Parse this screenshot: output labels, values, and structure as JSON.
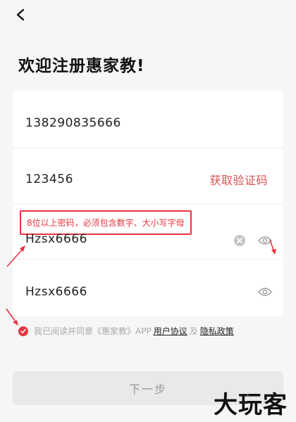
{
  "header": {
    "back_icon": "chevron-left-icon"
  },
  "page": {
    "title": "欢迎注册惠家教!"
  },
  "form": {
    "phone_value": "138290835666",
    "code_value": "123456",
    "get_code_label": "获取验证码",
    "password_hint": "8位以上密码，必须包含数字、大小写字母",
    "password_value": "Hzsx6666",
    "confirm_value": "Hzsx6666"
  },
  "agreement": {
    "prefix": "我已阅读并同意《惠家教》APP",
    "user_agreement": "用户协议",
    "and": "及",
    "privacy_policy": "隐私政策"
  },
  "next_label": "下一步",
  "watermark": "大玩客",
  "colors": {
    "accent": "#e8353f",
    "link_red": "#d9534f",
    "background": "#f6f6f6"
  }
}
